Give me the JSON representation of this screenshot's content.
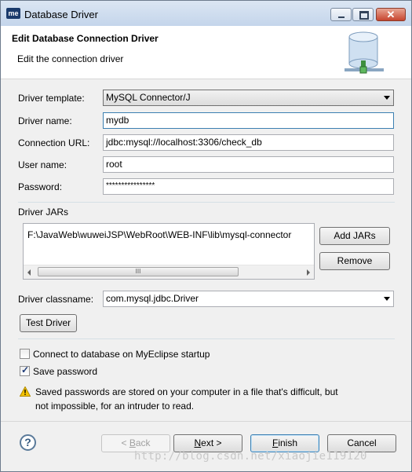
{
  "window": {
    "app_icon_text": "me",
    "title": "Database Driver"
  },
  "header": {
    "title": "Edit Database Connection Driver",
    "subtitle": "Edit the connection driver"
  },
  "form": {
    "driver_template_label": "Driver template:",
    "driver_template_value": "MySQL Connector/J",
    "driver_name_label": "Driver name:",
    "driver_name_value": "mydb",
    "connection_url_label": "Connection URL:",
    "connection_url_value": "jdbc:mysql://localhost:3306/check_db",
    "user_name_label": "User name:",
    "user_name_value": "root",
    "password_label": "Password:",
    "password_value": "****************"
  },
  "jars": {
    "section_label": "Driver JARs",
    "items": [
      "F:\\JavaWeb\\wuweiJSP\\WebRoot\\WEB-INF\\lib\\mysql-connector"
    ],
    "add_button": "Add JARs",
    "remove_button": "Remove",
    "scroll_thumb_grip": "III"
  },
  "classname": {
    "label": "Driver classname:",
    "value": "com.mysql.jdbc.Driver"
  },
  "test_button": "Test Driver",
  "options": {
    "connect_startup_label": "Connect to database on MyEclipse startup",
    "connect_startup_checked": false,
    "save_password_label": "Save password",
    "save_password_checked": true,
    "warning_line1": "Saved passwords are stored on your computer in a file that's difficult, but",
    "warning_line2": "not impossible, for an intruder to read."
  },
  "footer": {
    "help_symbol": "?",
    "back_prefix": "< ",
    "back_key": "B",
    "back_rest": "ack",
    "next_key": "N",
    "next_rest": "ext >",
    "finish_key": "F",
    "finish_rest": "inish",
    "cancel": "Cancel"
  },
  "watermark": "http://blog.csdn.net/xiaojie119120",
  "colors": {
    "accent": "#3c7fb1",
    "titlebar": "#c4d5eb",
    "warning": "#f5c400"
  }
}
